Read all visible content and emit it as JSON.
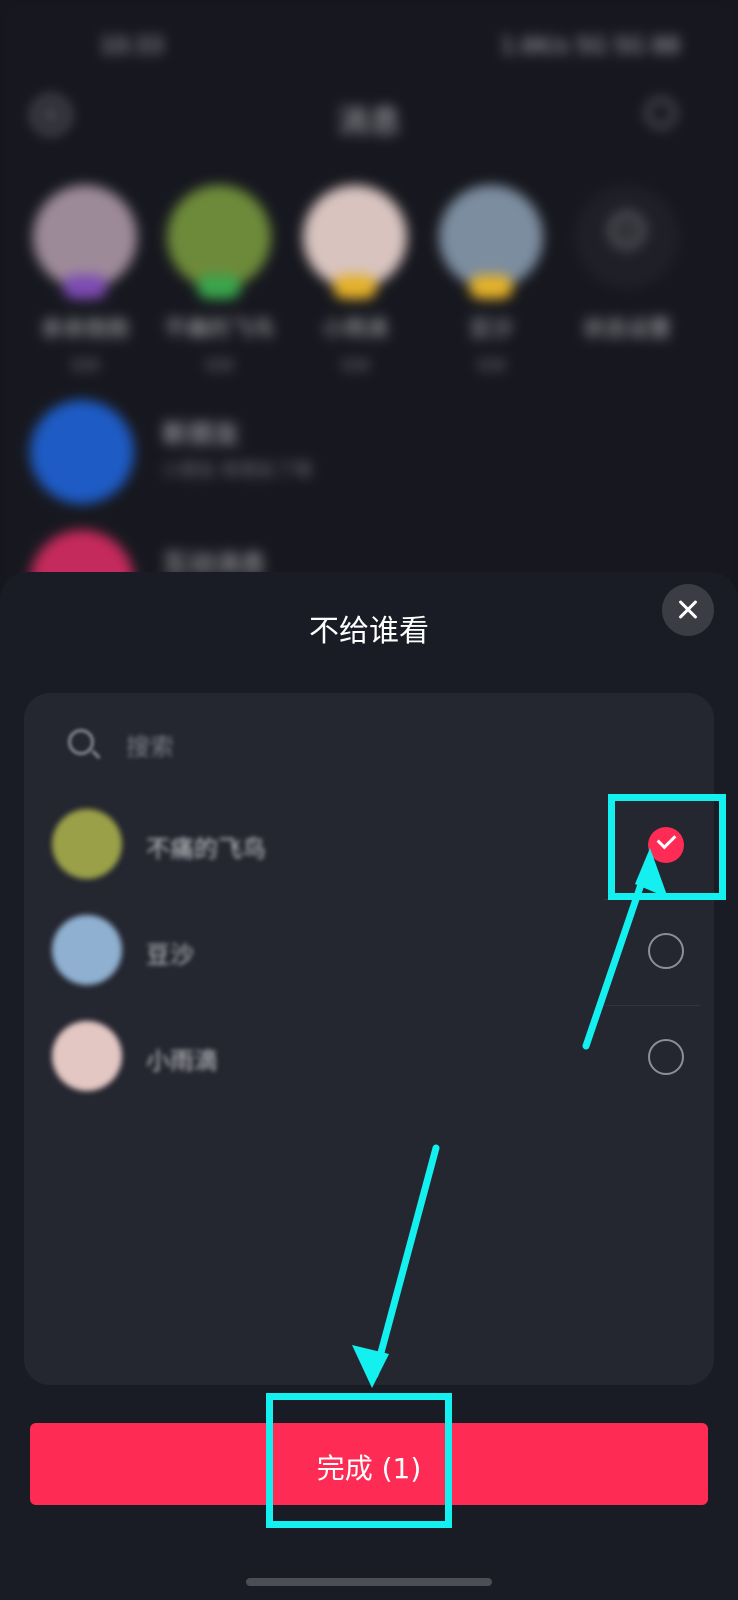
{
  "status_bar": {
    "time": "10:33",
    "right": "1.6K/s 5G 5G 88"
  },
  "header": {
    "title": "消息"
  },
  "stories": [
    {
      "name": "亲亲抱抱",
      "sub": "在线",
      "color": "#9d8a99",
      "badge": "#7d4bb3"
    },
    {
      "name": "不痛的飞鸟",
      "sub": "在线",
      "color": "#6d8a3a",
      "badge": "#3aa54b"
    },
    {
      "name": "小雨滴",
      "sub": "在线",
      "color": "#d8c3bf",
      "badge": "#e4b12a"
    },
    {
      "name": "豆沙",
      "sub": "在线",
      "color": "#7c8da0",
      "badge": "#e4b12a"
    },
    {
      "name": "状态设置",
      "sub": ""
    }
  ],
  "chats": [
    {
      "name": "新朋友",
      "preview": "小朋友 新朋友了哦",
      "color": "#1e5bc4"
    },
    {
      "name": "互动消息",
      "preview": "",
      "color": "#c52a5c"
    }
  ],
  "sheet": {
    "title": "不给谁看",
    "search_placeholder": "搜索",
    "items": [
      {
        "name": "不痛的飞鸟",
        "checked": true,
        "color": "#9aa048"
      },
      {
        "name": "豆沙",
        "checked": false,
        "color": "#8fb0d0"
      },
      {
        "name": "小雨滴",
        "checked": false,
        "color": "#e2c7c3"
      }
    ],
    "done_label": "完成 (1)"
  },
  "colors": {
    "accent": "#fe2c55",
    "annotation": "#14f0f0",
    "panel": "#242630"
  }
}
